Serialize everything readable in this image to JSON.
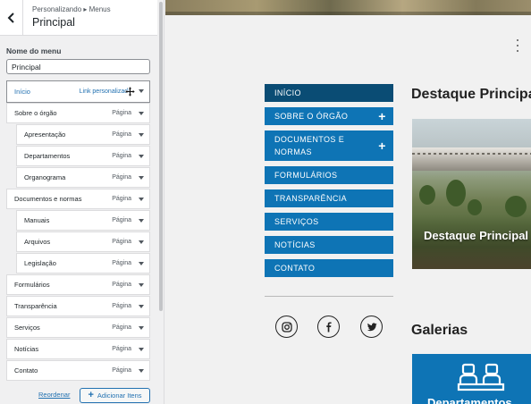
{
  "panel": {
    "breadcrumb": "Personalizando ▸ Menus",
    "title": "Principal",
    "field_label": "Nome do menu",
    "menu_name_value": "Principal",
    "items": [
      {
        "label": "Início",
        "type": "Link personalizado",
        "level": 0,
        "active": true
      },
      {
        "label": "Sobre o órgão",
        "type": "Página",
        "level": 0
      },
      {
        "label": "Apresentação",
        "type": "Página",
        "level": 1
      },
      {
        "label": "Departamentos",
        "type": "Página",
        "level": 1
      },
      {
        "label": "Organograma",
        "type": "Página",
        "level": 1
      },
      {
        "label": "Documentos e normas",
        "type": "Página",
        "level": 0
      },
      {
        "label": "Manuais",
        "type": "Página",
        "level": 1
      },
      {
        "label": "Arquivos",
        "type": "Página",
        "level": 1
      },
      {
        "label": "Legislação",
        "type": "Página",
        "level": 1
      },
      {
        "label": "Formulários",
        "type": "Página",
        "level": 0
      },
      {
        "label": "Transparência",
        "type": "Página",
        "level": 0
      },
      {
        "label": "Serviços",
        "type": "Página",
        "level": 0
      },
      {
        "label": "Notícias",
        "type": "Página",
        "level": 0
      },
      {
        "label": "Contato",
        "type": "Página",
        "level": 0
      }
    ],
    "reorder_label": "Reordenar",
    "add_items_label": "Adicionar Itens"
  },
  "preview": {
    "nav": [
      {
        "label": "INÍCIO",
        "active": true,
        "expandable": false
      },
      {
        "label": "SOBRE O ÓRGÃO",
        "expandable": true
      },
      {
        "label": "DOCUMENTOS E NORMAS",
        "expandable": true
      },
      {
        "label": "FORMULÁRIOS",
        "expandable": false
      },
      {
        "label": "TRANSPARÊNCIA",
        "expandable": false
      },
      {
        "label": "SERVIÇOS",
        "expandable": false
      },
      {
        "label": "NOTÍCIAS",
        "expandable": false
      },
      {
        "label": "CONTATO",
        "expandable": false
      }
    ],
    "social": [
      "instagram-icon",
      "facebook-icon",
      "twitter-icon"
    ],
    "featured_heading": "Destaque Principal",
    "featured_caption": "Destaque Principal",
    "gallery_heading": "Galerias",
    "gallery_caption": "Departamentos"
  },
  "colors": {
    "nav_blue": "#0e74b5",
    "nav_active": "#0a4c74",
    "wp_link": "#2271b1"
  }
}
